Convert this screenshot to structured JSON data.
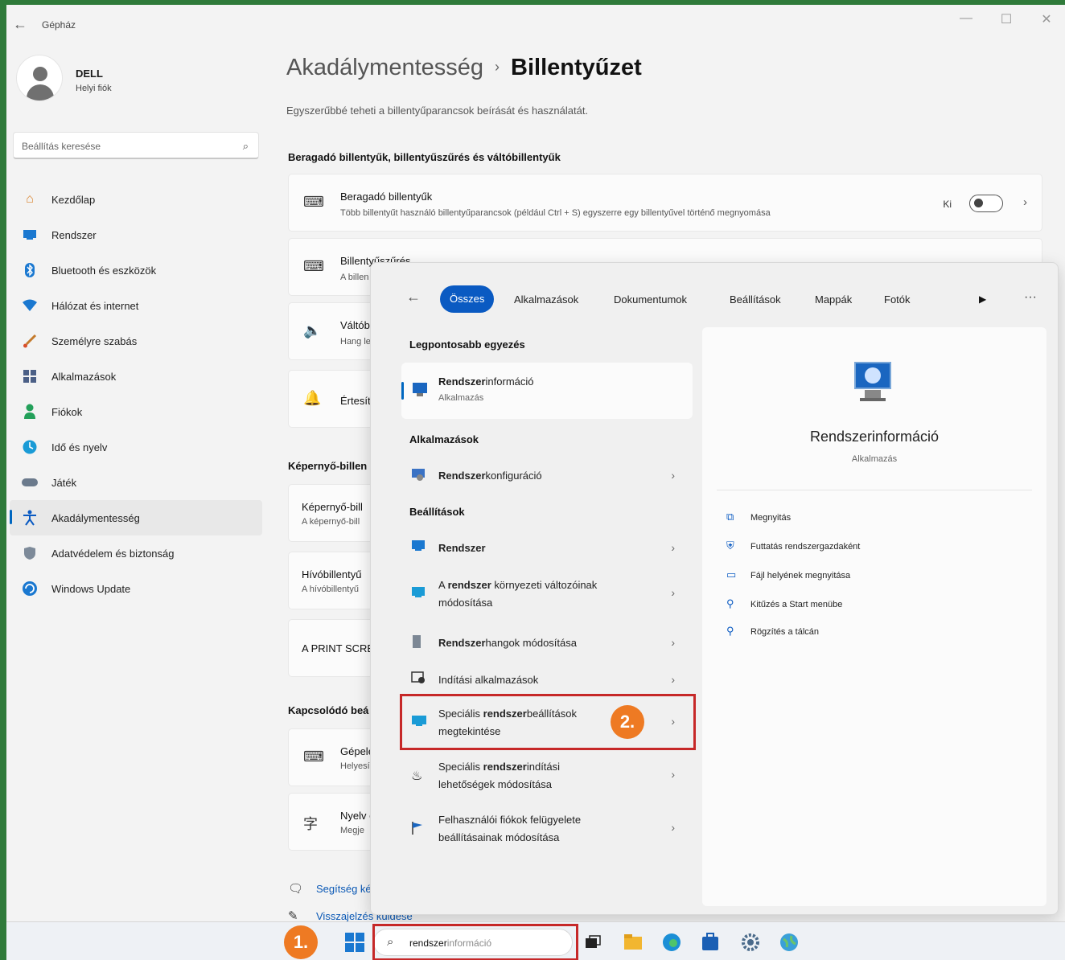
{
  "window": {
    "title": "Gépház",
    "back": "←",
    "minimize": "—",
    "maximize": "☐",
    "close": "✕"
  },
  "user": {
    "name": "DELL",
    "subtitle": "Helyi fiók"
  },
  "sidebar": {
    "search_placeholder": "Beállítás keresése",
    "items": [
      {
        "label": "Kezdőlap",
        "icon": "home-icon"
      },
      {
        "label": "Rendszer",
        "icon": "system-icon"
      },
      {
        "label": "Bluetooth és eszközök",
        "icon": "bluetooth-icon"
      },
      {
        "label": "Hálózat és internet",
        "icon": "network-icon"
      },
      {
        "label": "Személyre szabás",
        "icon": "brush-icon"
      },
      {
        "label": "Alkalmazások",
        "icon": "apps-icon"
      },
      {
        "label": "Fiókok",
        "icon": "accounts-icon"
      },
      {
        "label": "Idő és nyelv",
        "icon": "time-language-icon"
      },
      {
        "label": "Játék",
        "icon": "gaming-icon"
      },
      {
        "label": "Akadálymentesség",
        "icon": "accessibility-icon",
        "active": true
      },
      {
        "label": "Adatvédelem és biztonság",
        "icon": "shield-icon"
      },
      {
        "label": "Windows Update",
        "icon": "windows-update-icon"
      }
    ]
  },
  "main": {
    "breadcrumb_parent": "Akadálymentesség",
    "breadcrumb_sep": "›",
    "breadcrumb_current": "Billentyűzet",
    "description": "Egyszerűbbé teheti a billentyűparancsok beírását és használatát.",
    "section1": "Beragadó billentyűk, billentyűszűrés és váltóbillentyűk",
    "card_sticky": {
      "title": "Beragadó billentyűk",
      "subtitle": "Több billentyűt használó billentyűparancsok (például Ctrl + S) egyszerre egy billentyűvel történő megnyomása",
      "toggle_label": "Ki",
      "toggle_on": false
    },
    "card_filter": {
      "title": "Billentyűszűrés",
      "subtitle": "A billen"
    },
    "card_toggle_keys": {
      "title": "Váltób",
      "subtitle": "Hang le"
    },
    "card_notify": {
      "title": "Értesít"
    },
    "section2": "Képernyő-billen",
    "card_osk": {
      "title": "Képernyő-bill",
      "subtitle": "A képernyő-bill"
    },
    "card_access": {
      "title": "Hívóbillentyű",
      "subtitle": "A hívóbillentyű"
    },
    "card_print": {
      "title": "A PRINT SCRE"
    },
    "section3": "Kapcsolódó beá",
    "card_typing": {
      "title": "Gépele",
      "subtitle": "Helyesí"
    },
    "card_lang": {
      "title": "Nyelv é",
      "subtitle": "Megje"
    },
    "help_link": "Segítség ké",
    "feedback_link": "Visszajelzés küldése"
  },
  "search_overlay": {
    "filters": [
      "Összes",
      "Alkalmazások",
      "Dokumentumok",
      "Beállítások",
      "Mappák",
      "Fotók"
    ],
    "best_match_header": "Legpontosabb egyezés",
    "best_match": {
      "title_bold": "Rendszer",
      "title_rest": "információ",
      "subtitle": "Alkalmazás"
    },
    "apps_header": "Alkalmazások",
    "apps": [
      {
        "bold": "Rendszer",
        "rest": "konfiguráció"
      }
    ],
    "settings_header": "Beállítások",
    "settings": [
      {
        "line1_bold": "Rendszer",
        "line1_rest": ""
      },
      {
        "line1_pre": "A ",
        "line1_bold": "rendszer",
        "line1_rest": " környezeti változóinak",
        "line2": "módosítása"
      },
      {
        "line1_bold": "Rendszer",
        "line1_rest": "hangok módosítása"
      },
      {
        "line1_bold": "",
        "line1_rest": "Indítási alkalmazások"
      },
      {
        "line1_pre": "Speciális ",
        "line1_bold": "rendszer",
        "line1_rest": "beállítások",
        "line2": "megtekintése"
      },
      {
        "line1_pre": "Speciális ",
        "line1_bold": "rendszer",
        "line1_rest": "indítási",
        "line2": "lehetőségek módosítása"
      },
      {
        "line1_pre": "Felhasználói fiókok felügyelete",
        "line1_bold": "",
        "line1_rest": "",
        "line2": "beállításainak módosítása"
      }
    ],
    "step2": "2.",
    "detail": {
      "title": "Rendszerinformáció",
      "subtitle": "Alkalmazás",
      "actions": [
        {
          "label": "Megnyitás",
          "icon": "open-icon"
        },
        {
          "label": "Futtatás rendszergazdaként",
          "icon": "run-as-admin-icon"
        },
        {
          "label": "Fájl helyének megnyitása",
          "icon": "folder-icon"
        },
        {
          "label": "Kitűzés a Start menübe",
          "icon": "pin-icon"
        },
        {
          "label": "Rögzítés a tálcán",
          "icon": "pin-icon"
        }
      ]
    }
  },
  "taskbar": {
    "step1": "1.",
    "search_typed": "rendszer",
    "search_ghost": "információ"
  },
  "colors": {
    "accent": "#0a5ac2",
    "highlight": "#c62828",
    "step_badge": "#ee7a23",
    "frame": "#2f7a3a"
  }
}
